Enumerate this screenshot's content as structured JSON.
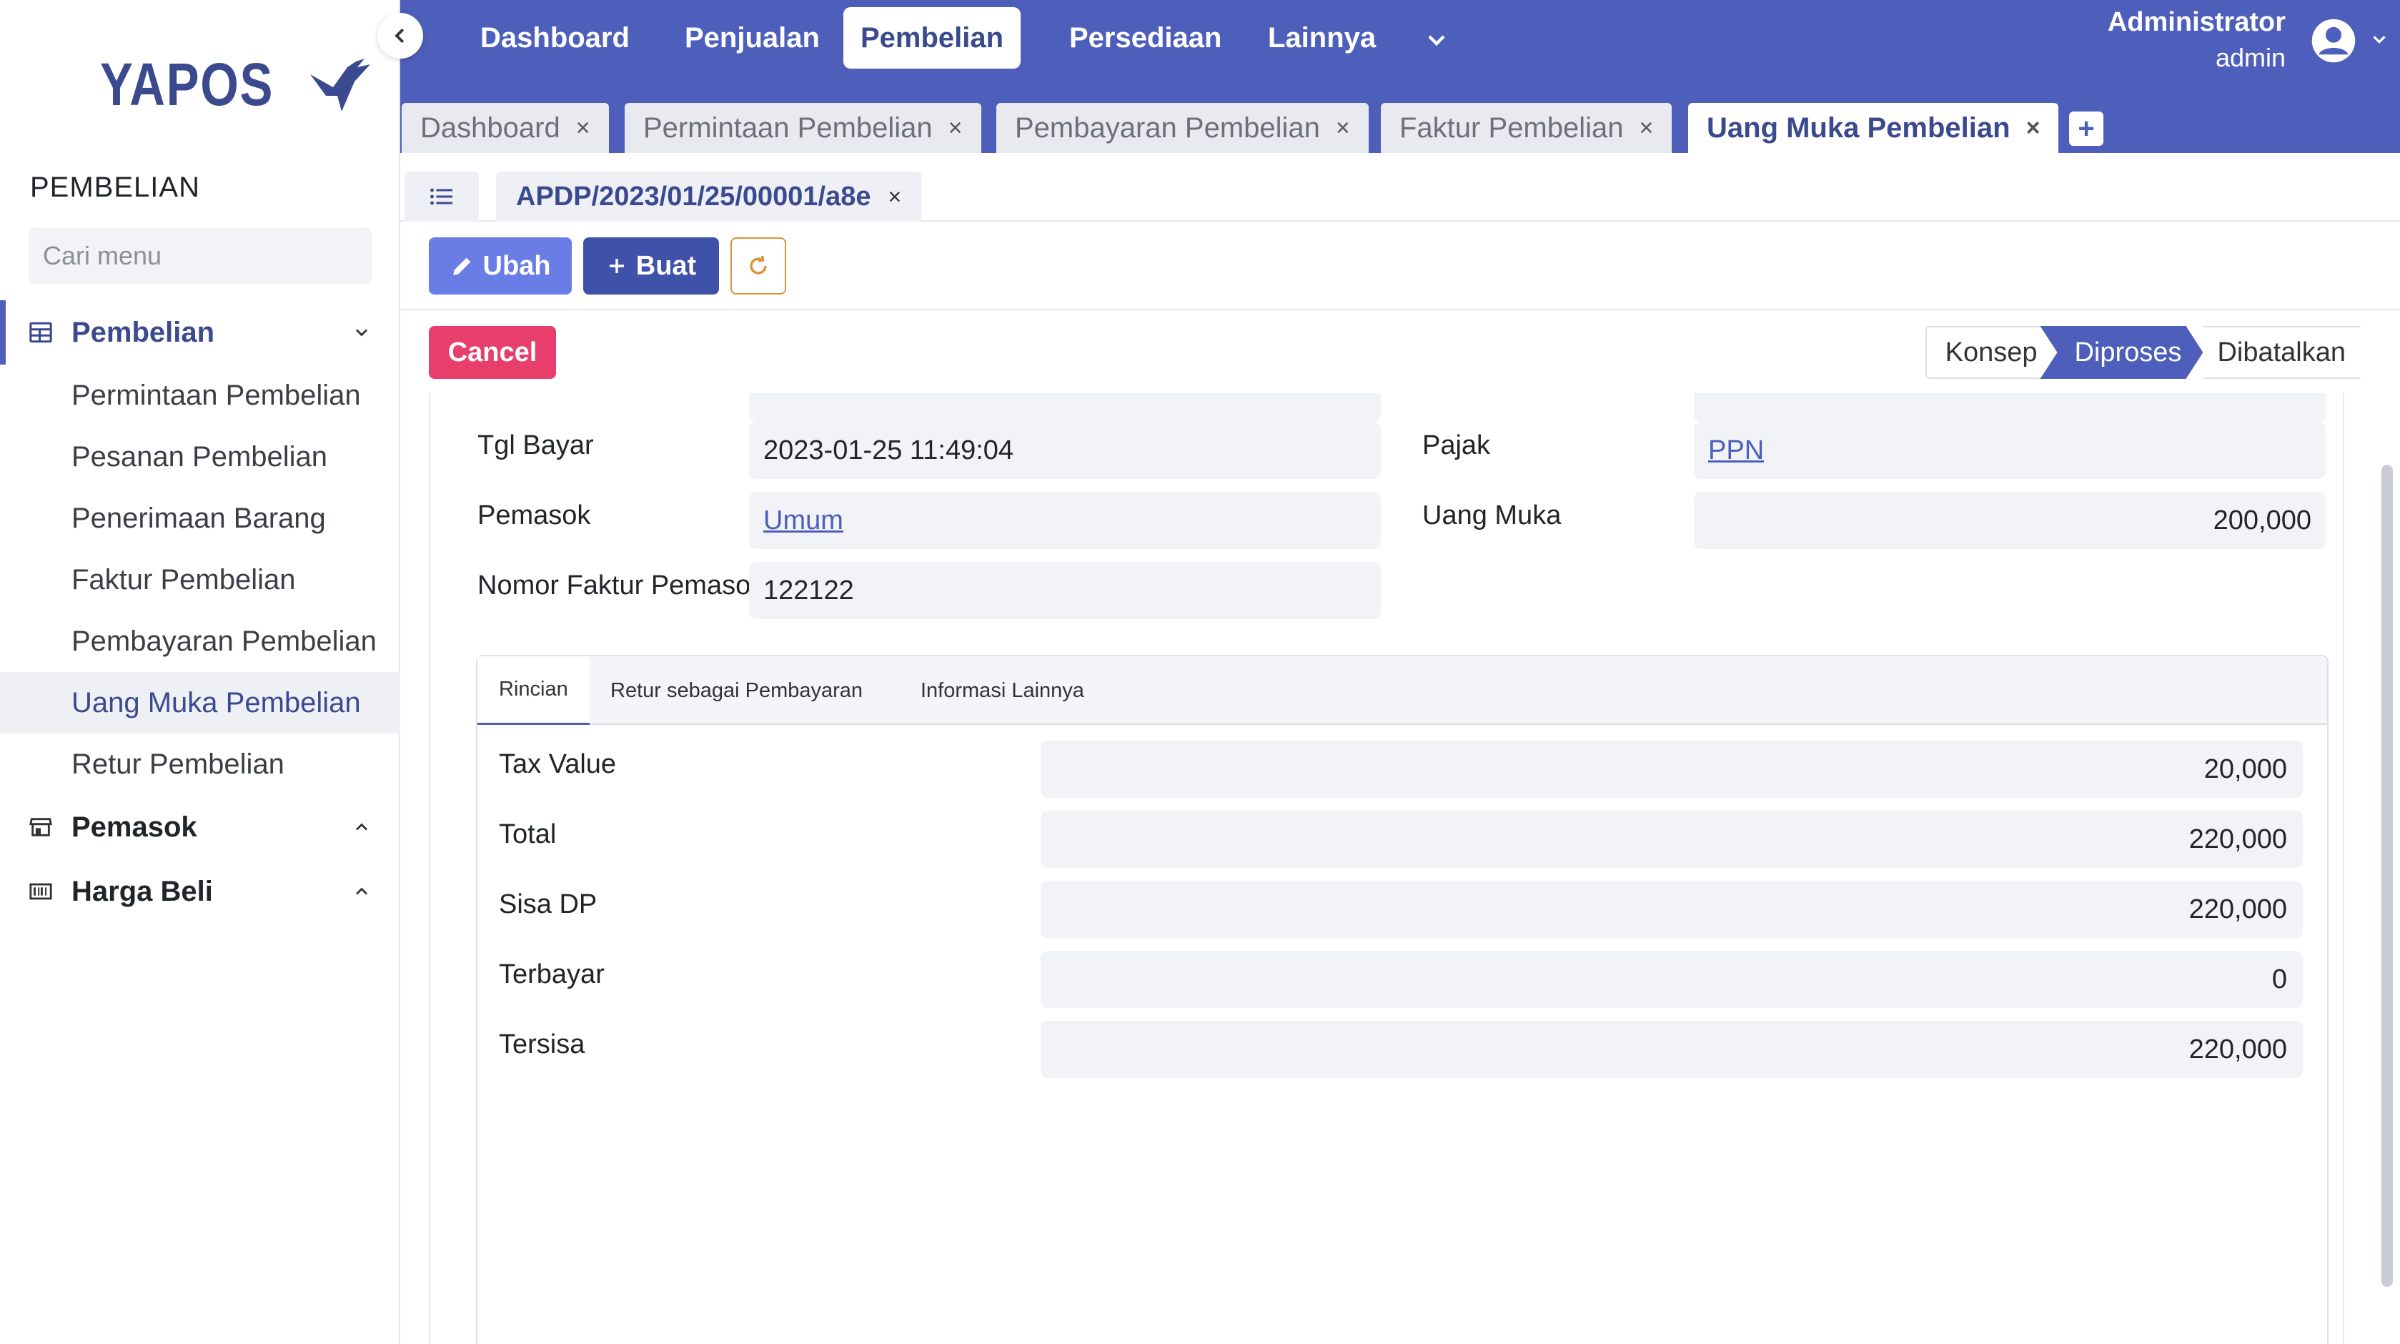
{
  "brand": {
    "logo_text": "YAPOS"
  },
  "sidebar": {
    "section_title": "PEMBELIAN",
    "search_placeholder": "Cari menu",
    "groups": [
      {
        "label": "Pembelian",
        "icon": "table-icon",
        "expanded": true
      },
      {
        "label": "Pemasok",
        "icon": "store-icon",
        "expanded": false
      },
      {
        "label": "Harga Beli",
        "icon": "barcode-icon",
        "expanded": false
      }
    ],
    "items": [
      {
        "label": "Permintaan Pembelian"
      },
      {
        "label": "Pesanan Pembelian"
      },
      {
        "label": "Penerimaan Barang"
      },
      {
        "label": "Faktur Pembelian"
      },
      {
        "label": "Pembayaran Pembelian"
      },
      {
        "label": "Uang Muka Pembelian",
        "active": true
      },
      {
        "label": "Retur Pembelian"
      }
    ]
  },
  "topnav": {
    "items": [
      {
        "label": "Dashboard"
      },
      {
        "label": "Penjualan"
      },
      {
        "label": "Pembelian",
        "active": true
      },
      {
        "label": "Persediaan"
      },
      {
        "label": "Lainnya"
      }
    ],
    "user_name": "Administrator",
    "user_role": "admin"
  },
  "tabs": [
    {
      "label": "Dashboard",
      "close": "×"
    },
    {
      "label": "Permintaan Pembelian",
      "close": "×"
    },
    {
      "label": "Pembayaran Pembelian",
      "close": "×"
    },
    {
      "label": "Faktur Pembelian",
      "close": "×"
    },
    {
      "label": "Uang Muka Pembelian",
      "close": "×",
      "active": true
    }
  ],
  "tab_add": "+",
  "document": {
    "number": "APDP/2023/01/25/00001/a8e",
    "close": "×"
  },
  "toolbar": {
    "edit_label": "Ubah",
    "create_label": "Buat"
  },
  "status": {
    "cancel_label": "Cancel",
    "stages": [
      {
        "label": "Konsep"
      },
      {
        "label": "Diproses",
        "active": true
      },
      {
        "label": "Dibatalkan"
      }
    ]
  },
  "form": {
    "left": [
      {
        "label": "Tgl Bayar",
        "value": "2023-01-25  11:49:04"
      },
      {
        "label": "Pemasok",
        "value": "Umum",
        "link": true
      },
      {
        "label": "Nomor Faktur Pemasok",
        "value": "122122"
      }
    ],
    "right": [
      {
        "label": "Pajak",
        "value": "PPN",
        "link": true
      },
      {
        "label": "Uang Muka",
        "value": "200,000"
      }
    ]
  },
  "detail_tabs": [
    {
      "label": "Rincian",
      "active": true
    },
    {
      "label": "Retur sebagai Pembayaran"
    },
    {
      "label": "Informasi Lainnya"
    }
  ],
  "detail_rows": [
    {
      "label": "Tax Value",
      "value": "20,000"
    },
    {
      "label": "Total",
      "value": "220,000"
    },
    {
      "label": "Sisa DP",
      "value": "220,000"
    },
    {
      "label": "Terbayar",
      "value": "0"
    },
    {
      "label": "Tersisa",
      "value": "220,000"
    }
  ],
  "colors": {
    "primary": "#4e5fbb",
    "danger": "#e83e6c",
    "warning": "#e0903a"
  }
}
